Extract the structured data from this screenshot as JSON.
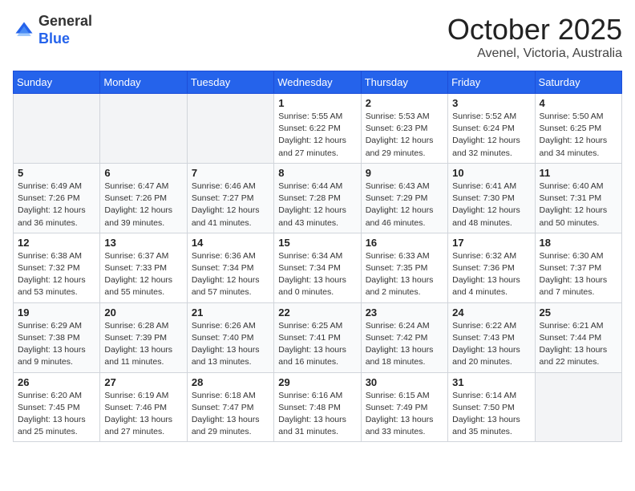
{
  "header": {
    "logo_general": "General",
    "logo_blue": "Blue",
    "month_title": "October 2025",
    "location": "Avenel, Victoria, Australia"
  },
  "days_of_week": [
    "Sunday",
    "Monday",
    "Tuesday",
    "Wednesday",
    "Thursday",
    "Friday",
    "Saturday"
  ],
  "weeks": [
    [
      {
        "day": "",
        "info": ""
      },
      {
        "day": "",
        "info": ""
      },
      {
        "day": "",
        "info": ""
      },
      {
        "day": "1",
        "info": "Sunrise: 5:55 AM\nSunset: 6:22 PM\nDaylight: 12 hours\nand 27 minutes."
      },
      {
        "day": "2",
        "info": "Sunrise: 5:53 AM\nSunset: 6:23 PM\nDaylight: 12 hours\nand 29 minutes."
      },
      {
        "day": "3",
        "info": "Sunrise: 5:52 AM\nSunset: 6:24 PM\nDaylight: 12 hours\nand 32 minutes."
      },
      {
        "day": "4",
        "info": "Sunrise: 5:50 AM\nSunset: 6:25 PM\nDaylight: 12 hours\nand 34 minutes."
      }
    ],
    [
      {
        "day": "5",
        "info": "Sunrise: 6:49 AM\nSunset: 7:26 PM\nDaylight: 12 hours\nand 36 minutes."
      },
      {
        "day": "6",
        "info": "Sunrise: 6:47 AM\nSunset: 7:26 PM\nDaylight: 12 hours\nand 39 minutes."
      },
      {
        "day": "7",
        "info": "Sunrise: 6:46 AM\nSunset: 7:27 PM\nDaylight: 12 hours\nand 41 minutes."
      },
      {
        "day": "8",
        "info": "Sunrise: 6:44 AM\nSunset: 7:28 PM\nDaylight: 12 hours\nand 43 minutes."
      },
      {
        "day": "9",
        "info": "Sunrise: 6:43 AM\nSunset: 7:29 PM\nDaylight: 12 hours\nand 46 minutes."
      },
      {
        "day": "10",
        "info": "Sunrise: 6:41 AM\nSunset: 7:30 PM\nDaylight: 12 hours\nand 48 minutes."
      },
      {
        "day": "11",
        "info": "Sunrise: 6:40 AM\nSunset: 7:31 PM\nDaylight: 12 hours\nand 50 minutes."
      }
    ],
    [
      {
        "day": "12",
        "info": "Sunrise: 6:38 AM\nSunset: 7:32 PM\nDaylight: 12 hours\nand 53 minutes."
      },
      {
        "day": "13",
        "info": "Sunrise: 6:37 AM\nSunset: 7:33 PM\nDaylight: 12 hours\nand 55 minutes."
      },
      {
        "day": "14",
        "info": "Sunrise: 6:36 AM\nSunset: 7:34 PM\nDaylight: 12 hours\nand 57 minutes."
      },
      {
        "day": "15",
        "info": "Sunrise: 6:34 AM\nSunset: 7:34 PM\nDaylight: 13 hours\nand 0 minutes."
      },
      {
        "day": "16",
        "info": "Sunrise: 6:33 AM\nSunset: 7:35 PM\nDaylight: 13 hours\nand 2 minutes."
      },
      {
        "day": "17",
        "info": "Sunrise: 6:32 AM\nSunset: 7:36 PM\nDaylight: 13 hours\nand 4 minutes."
      },
      {
        "day": "18",
        "info": "Sunrise: 6:30 AM\nSunset: 7:37 PM\nDaylight: 13 hours\nand 7 minutes."
      }
    ],
    [
      {
        "day": "19",
        "info": "Sunrise: 6:29 AM\nSunset: 7:38 PM\nDaylight: 13 hours\nand 9 minutes."
      },
      {
        "day": "20",
        "info": "Sunrise: 6:28 AM\nSunset: 7:39 PM\nDaylight: 13 hours\nand 11 minutes."
      },
      {
        "day": "21",
        "info": "Sunrise: 6:26 AM\nSunset: 7:40 PM\nDaylight: 13 hours\nand 13 minutes."
      },
      {
        "day": "22",
        "info": "Sunrise: 6:25 AM\nSunset: 7:41 PM\nDaylight: 13 hours\nand 16 minutes."
      },
      {
        "day": "23",
        "info": "Sunrise: 6:24 AM\nSunset: 7:42 PM\nDaylight: 13 hours\nand 18 minutes."
      },
      {
        "day": "24",
        "info": "Sunrise: 6:22 AM\nSunset: 7:43 PM\nDaylight: 13 hours\nand 20 minutes."
      },
      {
        "day": "25",
        "info": "Sunrise: 6:21 AM\nSunset: 7:44 PM\nDaylight: 13 hours\nand 22 minutes."
      }
    ],
    [
      {
        "day": "26",
        "info": "Sunrise: 6:20 AM\nSunset: 7:45 PM\nDaylight: 13 hours\nand 25 minutes."
      },
      {
        "day": "27",
        "info": "Sunrise: 6:19 AM\nSunset: 7:46 PM\nDaylight: 13 hours\nand 27 minutes."
      },
      {
        "day": "28",
        "info": "Sunrise: 6:18 AM\nSunset: 7:47 PM\nDaylight: 13 hours\nand 29 minutes."
      },
      {
        "day": "29",
        "info": "Sunrise: 6:16 AM\nSunset: 7:48 PM\nDaylight: 13 hours\nand 31 minutes."
      },
      {
        "day": "30",
        "info": "Sunrise: 6:15 AM\nSunset: 7:49 PM\nDaylight: 13 hours\nand 33 minutes."
      },
      {
        "day": "31",
        "info": "Sunrise: 6:14 AM\nSunset: 7:50 PM\nDaylight: 13 hours\nand 35 minutes."
      },
      {
        "day": "",
        "info": ""
      }
    ]
  ]
}
